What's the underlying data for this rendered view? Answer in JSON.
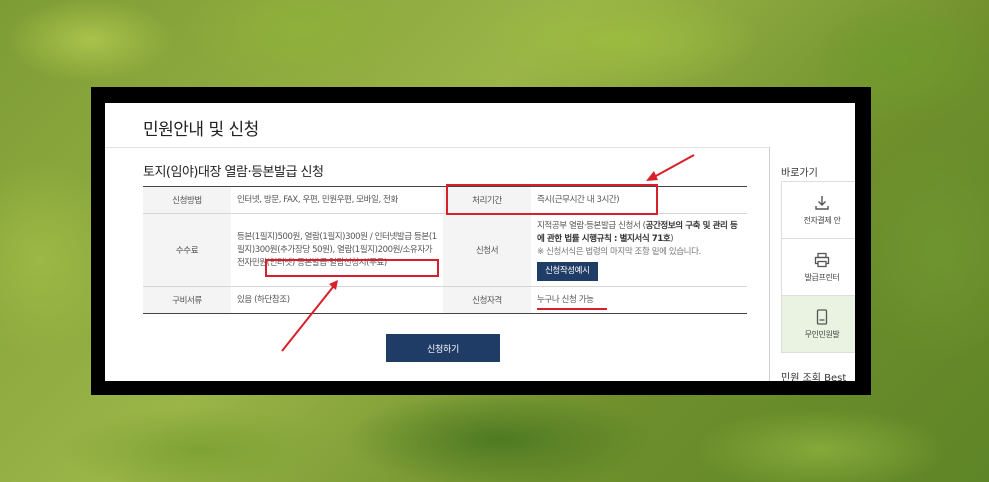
{
  "page_title": "민원안내 및 신청",
  "section_title": "토지(임야)대장 열람·등본발급 신청",
  "table": {
    "row1": {
      "label": "신청방법",
      "value": "인터넷, 방문, FAX, 우편, 민원우편, 모바일, 전화",
      "label2": "처리기간",
      "value2": "즉시(근무시간 내 3시간)"
    },
    "row2": {
      "label": "수수료",
      "value_part1": "등본(1필지)500원, 열람(1필지)300원 / 인터넷발급 등본(1필지)300원(추가장당 50원), 열람(1필지)200원/소유자가 ",
      "value_highlight": "전자민원(인터넷) 등본발급·열람신청시(무료)",
      "label2": "신청서",
      "value2_part1": "지적공부 열람·등본발급 신청서 (",
      "value2_strong": "공간정보의 구축 및 관리 등에 관한 법률 시행규칙 : 별지서식 71호",
      "value2_part2": ")",
      "value2_note": "※ 신청서식은 법령의 마지막 조항 밑에 있습니다.",
      "form_button": "신청작성예시"
    },
    "row3": {
      "label": "구비서류",
      "value": "있음 (하단참조)",
      "label2": "신청자격",
      "value2": "누구나 신청 가능"
    }
  },
  "apply_button": "신청하기",
  "sidebar": {
    "shortcut_title": "바로가기",
    "items": [
      {
        "label": "전자결제 안",
        "icon": "download-icon"
      },
      {
        "label": "발급프린터",
        "icon": "printer-icon"
      },
      {
        "label": "무인민원발",
        "icon": "kiosk-icon"
      }
    ],
    "best_title": "민원 조회 Best"
  },
  "colors": {
    "navy": "#1f3c66",
    "annotation_red": "#d8202a"
  }
}
